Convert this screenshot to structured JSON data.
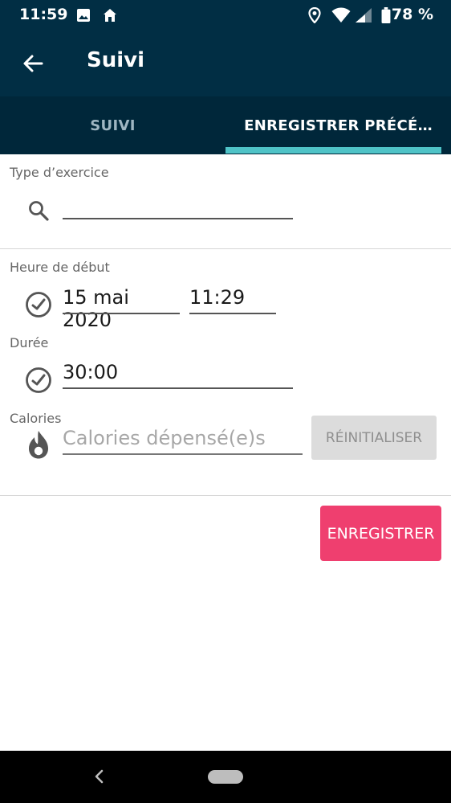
{
  "status_bar": {
    "time": "11:59",
    "battery": "78 %",
    "icons": [
      "image-icon",
      "home-icon",
      "location-icon",
      "wifi-icon",
      "signal-icon",
      "battery-icon"
    ]
  },
  "toolbar": {
    "title": "Suivi",
    "back_icon": "back-arrow-icon"
  },
  "tabs": [
    {
      "label": "SUIVI",
      "selected": false
    },
    {
      "label": "ENREGISTRER PRÉCÉ…",
      "selected": true
    }
  ],
  "form": {
    "exercise_type_label": "Type d’exercice",
    "exercise_type_value": "",
    "start_time_label": "Heure de début",
    "start_date": "15 mai 2020",
    "start_time": "11:29",
    "duration_label": "Durée",
    "duration": "30:00",
    "calories_label": "Calories",
    "calories_placeholder": "Calories dépensé(e)s",
    "reset_label": "RÉINITIALISER"
  },
  "save_label": "ENREGISTRER",
  "colors": {
    "header": "#012e44",
    "tabs": "#00273a",
    "indicator": "#4fc3c7",
    "save": "#ef3f6f",
    "reset": "#dcdcdc"
  }
}
